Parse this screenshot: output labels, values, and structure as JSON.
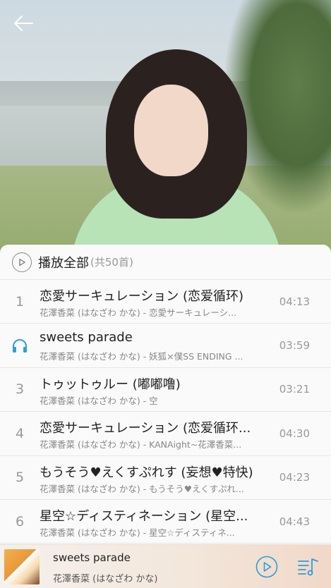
{
  "header": {
    "back_icon": "arrow-left-icon"
  },
  "list": {
    "play_all_label": "播放全部",
    "count_label": "(共50首)",
    "songs": [
      {
        "num": "1",
        "title": "恋愛サーキュレーション (恋爱循环)",
        "subtitle": "花澤香菜 (はなざわ かな) - 恋愛サーキュレーシ...",
        "duration": "04:13",
        "playing": false
      },
      {
        "num": "",
        "title": "sweets parade",
        "subtitle": "花澤香菜 (はなざわ かな) - 妖狐×僕SS ENDING ...",
        "duration": "03:59",
        "playing": true
      },
      {
        "num": "3",
        "title": "トゥットゥルー (嘟嘟噜)",
        "subtitle": "花澤香菜 (はなざわ かな) - 空",
        "duration": "03:21",
        "playing": false
      },
      {
        "num": "4",
        "title": "恋愛サーキュレーション (恋爱循环...",
        "subtitle": "花澤香菜 (はなざわ かな) - KANAight~花澤香菜...",
        "duration": "04:30",
        "playing": false
      },
      {
        "num": "5",
        "title": "もうそう♥えくすぷれす (妄想♥特快)",
        "subtitle": "花澤香菜 (はなざわ かな) - もうそう♥えくすぷれ...",
        "duration": "04:23",
        "playing": false
      },
      {
        "num": "6",
        "title": "星空☆ディスティネーション (星空...",
        "subtitle": "花澤香菜 (はなざわ かな) - 星空☆ディスティネ...",
        "duration": "04:43",
        "playing": false
      }
    ]
  },
  "player": {
    "title": "sweets parade",
    "artist": "花澤香菜 (はなざわ かな)",
    "play_icon": "play-circle-icon",
    "playlist_icon": "playlist-icon",
    "accent_color": "#2b9fd8"
  }
}
